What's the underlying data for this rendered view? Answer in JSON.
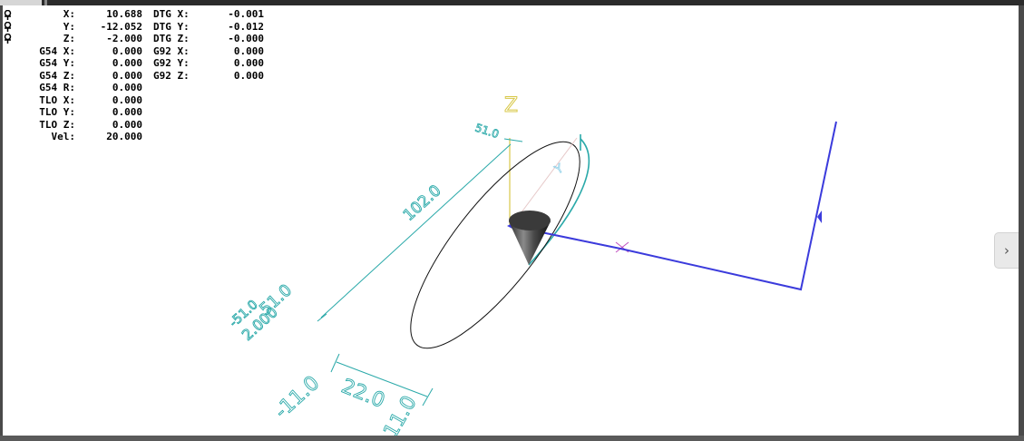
{
  "dro": {
    "rows": [
      {
        "label": "X:",
        "value": "10.688",
        "label2": "DTG X:",
        "value2": "-0.001"
      },
      {
        "label": "Y:",
        "value": "-12.052",
        "label2": "DTG Y:",
        "value2": "-0.012"
      },
      {
        "label": "Z:",
        "value": "-2.000",
        "label2": "DTG Z:",
        "value2": "-0.000"
      },
      {
        "label": "G54 X:",
        "value": "0.000",
        "label2": "G92 X:",
        "value2": "0.000"
      },
      {
        "label": "G54 Y:",
        "value": "0.000",
        "label2": "G92 Y:",
        "value2": "0.000"
      },
      {
        "label": "G54 Z:",
        "value": "0.000",
        "label2": "G92 Z:",
        "value2": "0.000"
      },
      {
        "label": "G54 R:",
        "value": "0.000"
      },
      {
        "label": "TLO X:",
        "value": "0.000"
      },
      {
        "label": "TLO Y:",
        "value": "0.000"
      },
      {
        "label": "TLO Z:",
        "value": "0.000"
      },
      {
        "label": "Vel:",
        "value": "20.000"
      }
    ]
  },
  "scene": {
    "axis_labels": {
      "z": "Z",
      "y": "Y"
    },
    "dimensions": {
      "d1": "51.0",
      "d2": "102.0",
      "d3": "51.0",
      "d4": "2.000",
      "d5": "-11.0",
      "d6": "22.0",
      "d7": "11.0",
      "d8": "-51.0"
    },
    "colors": {
      "dimension": "#2aa9a9",
      "axis_z": "#d8c84a",
      "path": "#3b3bdc",
      "traverse": "#9a4cd0",
      "origin": "#c050c0"
    }
  },
  "icons": {
    "pin": "pushpin-icon",
    "next": "chevron-right-icon"
  },
  "nav": {
    "next_label": "›"
  }
}
